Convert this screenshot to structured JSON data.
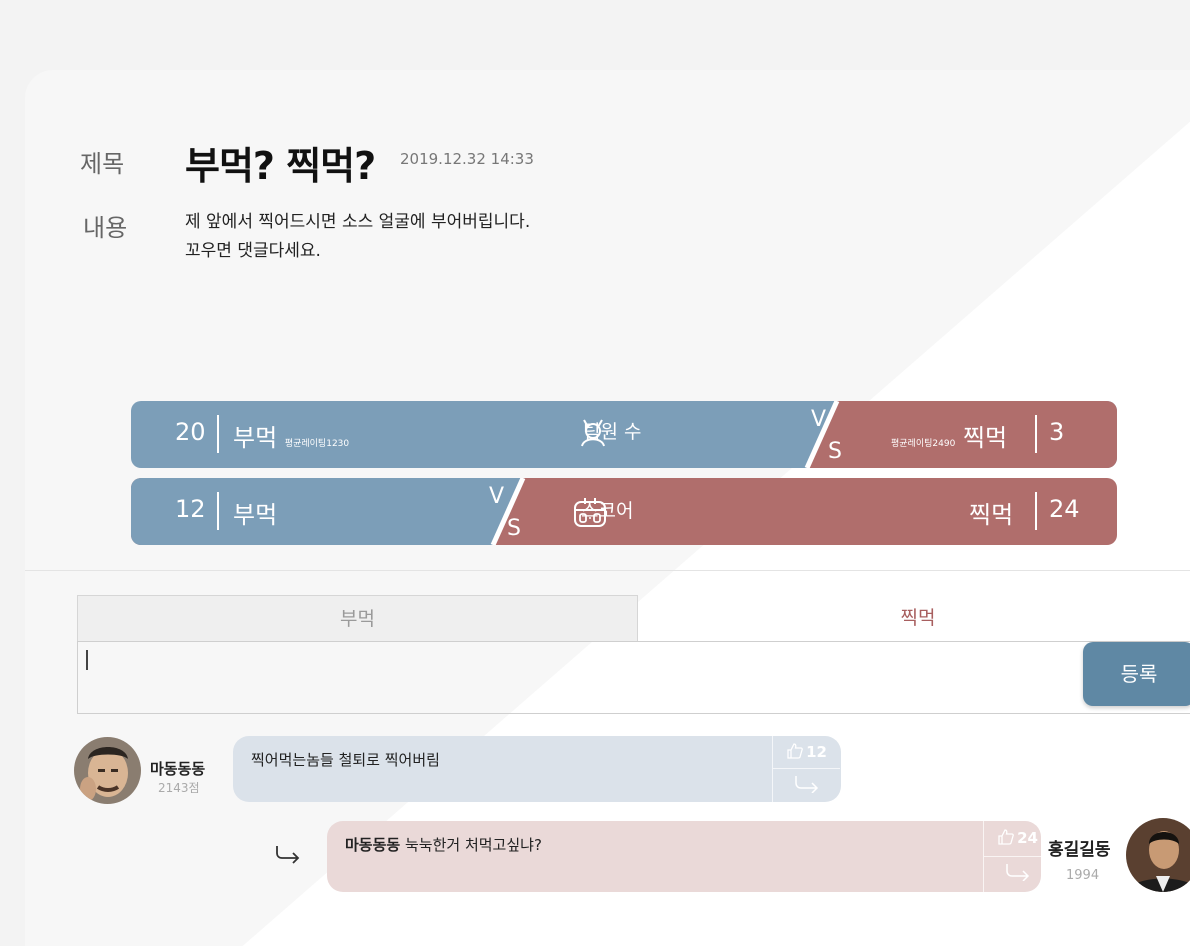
{
  "post": {
    "title_label": "제목",
    "title": "부먹? 찍먹?",
    "date": "2019.12.32  14:33",
    "content_label": "내용",
    "content_lines": [
      "제 앞에서 찍어드시면 소스 얼굴에 부어버립니다.",
      "꼬우면 댓글다세요."
    ]
  },
  "teams": {
    "row1": {
      "left_count": "20",
      "left_name": "부먹",
      "left_rating": "평균레이팅1230",
      "center_label": "팀원 수",
      "center_icon": "team-member-icon",
      "right_rating": "평균레이팅2490",
      "right_name": "찍먹",
      "right_count": "3",
      "vs_v": "V",
      "vs_s": "S"
    },
    "row2": {
      "left_count": "12",
      "left_name": "부먹",
      "center_label": "스코어",
      "center_icon": "scoreboard-icon",
      "right_name": "찍먹",
      "right_count": "24",
      "vs_v": "V",
      "vs_s": "S"
    }
  },
  "colors": {
    "blue_team": "#7c9eb8",
    "red_team": "#b06e6c",
    "register_button": "#5f88a4",
    "comment_blue": "#dbe2ea",
    "comment_red": "#ead9d8"
  },
  "comment_form": {
    "tab_left": "부먹",
    "tab_right": "찍먹",
    "selected_tab": "찍먹",
    "input_value": "",
    "submit_label": "등록"
  },
  "comments": [
    {
      "author": "마동동동",
      "score": "2143점",
      "text": "찍어먹는놈들 철퇴로 찍어버림",
      "likes": "12",
      "team": "부먹"
    },
    {
      "author": "홍길길동",
      "score": "1994",
      "mention": "마동동동",
      "text": "눅눅한거 처먹고싶냐?",
      "likes": "24",
      "team": "찍먹",
      "is_reply": true
    }
  ]
}
